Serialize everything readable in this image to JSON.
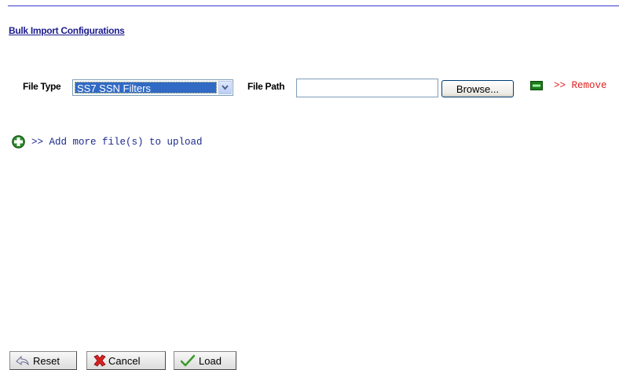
{
  "page": {
    "title": "Bulk Import Configurations"
  },
  "form": {
    "file_type_label": "File Type",
    "file_type_value": "SS7 SSN Filters",
    "file_path_label": "File Path",
    "file_path_value": "",
    "browse_label": "Browse...",
    "remove_label": ">> Remove",
    "add_more_label": ">> Add more file(s) to upload"
  },
  "actions": {
    "reset_label": "Reset",
    "cancel_label": "Cancel",
    "load_label": "Load"
  },
  "colors": {
    "title": "#1c1c8e",
    "remove": "#e02020",
    "add_more": "#1c2a8e",
    "selection": "#316ac5"
  },
  "icons": {
    "remove": "minus-icon",
    "add": "plus-icon",
    "reset": "undo-arrow-icon",
    "cancel": "red-x-icon",
    "load": "checkmark-icon"
  }
}
